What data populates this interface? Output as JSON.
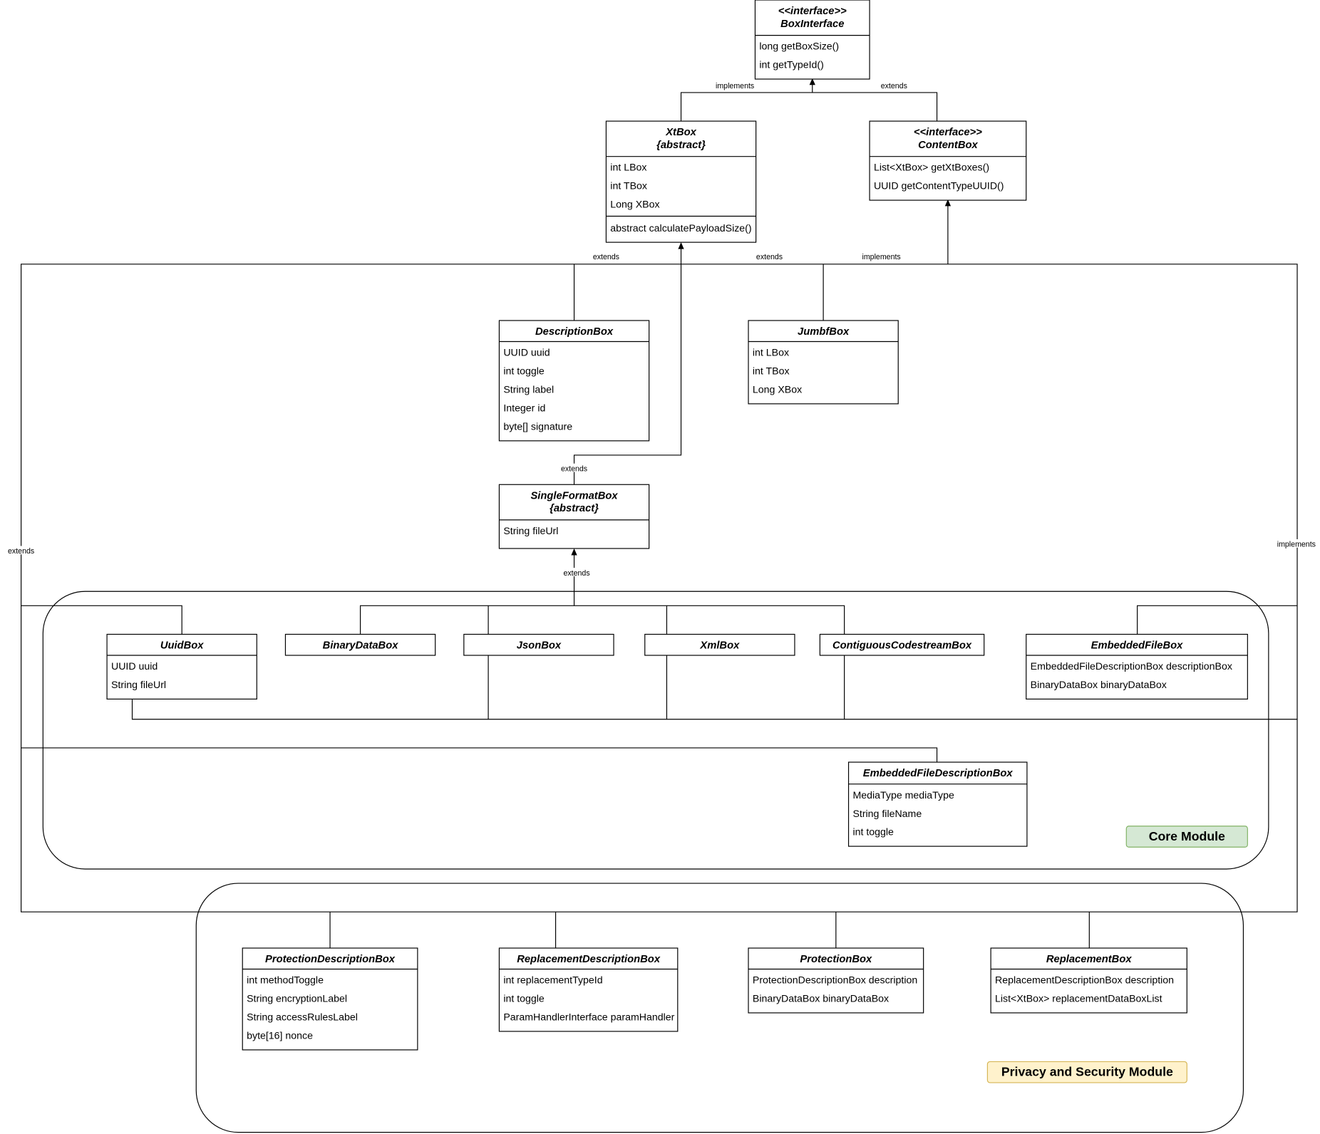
{
  "classes": [
    {
      "id": "BoxInterface",
      "title": [
        "<<interface>>",
        "BoxInterface"
      ],
      "attributes": [],
      "methods": [
        "long getBoxSize()",
        "int getTypeId()"
      ]
    },
    {
      "id": "XtBox",
      "title": [
        "XtBox",
        "{abstract}"
      ],
      "attributes": [
        "int LBox",
        "int TBox",
        "Long XBox"
      ],
      "methods": [
        "abstract calculatePayloadSize()"
      ]
    },
    {
      "id": "ContentBox",
      "title": [
        "<<interface>>",
        "ContentBox"
      ],
      "attributes": [],
      "methods": [
        "List<XtBox> getXtBoxes()",
        "UUID getContentTypeUUID()"
      ]
    },
    {
      "id": "DescriptionBox",
      "title": [
        "DescriptionBox"
      ],
      "attributes": [
        "UUID uuid",
        "int toggle",
        "String label",
        "Integer id",
        "byte[] signature"
      ],
      "methods": []
    },
    {
      "id": "JumbfBox",
      "title": [
        "JumbfBox"
      ],
      "attributes": [
        "int LBox",
        "int TBox",
        "Long XBox"
      ],
      "methods": []
    },
    {
      "id": "SingleFormatBox",
      "title": [
        "SingleFormatBox",
        "{abstract}"
      ],
      "attributes": [
        "String fileUrl"
      ],
      "methods": []
    },
    {
      "id": "UuidBox",
      "title": [
        "UuidBox"
      ],
      "attributes": [
        "UUID uuid",
        "String fileUrl"
      ],
      "methods": []
    },
    {
      "id": "BinaryDataBox",
      "title": [
        "BinaryDataBox"
      ],
      "attributes": [],
      "methods": []
    },
    {
      "id": "JsonBox",
      "title": [
        "JsonBox"
      ],
      "attributes": [],
      "methods": []
    },
    {
      "id": "XmlBox",
      "title": [
        "XmlBox"
      ],
      "attributes": [],
      "methods": []
    },
    {
      "id": "ContiguousCodestreamBox",
      "title": [
        "ContiguousCodestreamBox"
      ],
      "attributes": [],
      "methods": []
    },
    {
      "id": "EmbeddedFileBox",
      "title": [
        "EmbeddedFileBox"
      ],
      "attributes": [
        "EmbeddedFileDescriptionBox descriptionBox",
        "BinaryDataBox binaryDataBox"
      ],
      "methods": []
    },
    {
      "id": "EmbeddedFileDescriptionBox",
      "title": [
        "EmbeddedFileDescriptionBox"
      ],
      "attributes": [
        "MediaType mediaType",
        "String fileName",
        "int toggle"
      ],
      "methods": []
    },
    {
      "id": "ProtectionDescriptionBox",
      "title": [
        "ProtectionDescriptionBox"
      ],
      "attributes": [
        "int methodToggle",
        "String encryptionLabel",
        "String accessRulesLabel",
        "byte[16] nonce"
      ],
      "methods": []
    },
    {
      "id": "ReplacementDescriptionBox",
      "title": [
        "ReplacementDescriptionBox"
      ],
      "attributes": [
        "int replacementTypeId",
        "int toggle",
        "ParamHandlerInterface paramHandler"
      ],
      "methods": []
    },
    {
      "id": "ProtectionBox",
      "title": [
        "ProtectionBox"
      ],
      "attributes": [
        "ProtectionDescriptionBox description",
        "BinaryDataBox binaryDataBox"
      ],
      "methods": []
    },
    {
      "id": "ReplacementBox",
      "title": [
        "ReplacementBox"
      ],
      "attributes": [
        "ReplacementDescriptionBox description",
        "List<XtBox> replacementDataBoxList"
      ],
      "methods": []
    }
  ],
  "edge_labels": [
    "implements",
    "extends",
    "extends",
    "extends",
    "implements",
    "extends",
    "extends",
    "extends",
    "implements"
  ],
  "modules": [
    {
      "label": "Core Module",
      "fill": "#d5e8d4",
      "stroke": "#82b366"
    },
    {
      "label": "Privacy and Security Module",
      "fill": "#fff2cc",
      "stroke": "#d6b656"
    }
  ]
}
